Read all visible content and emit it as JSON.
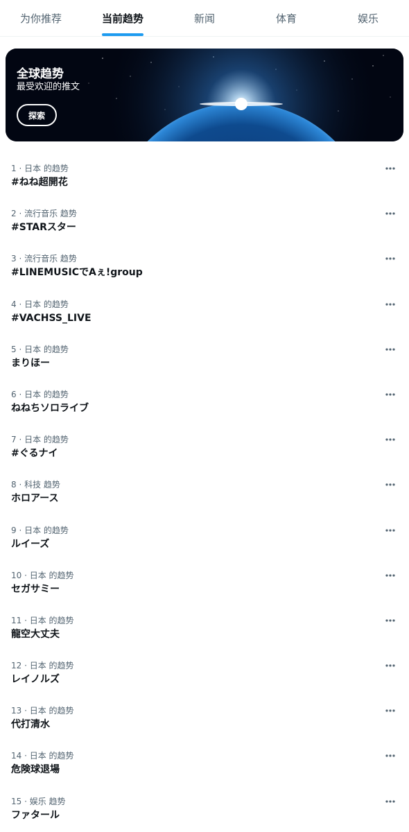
{
  "tabs": [
    {
      "label": "为你推荐",
      "active": false
    },
    {
      "label": "当前趋势",
      "active": true
    },
    {
      "label": "新闻",
      "active": false
    },
    {
      "label": "体育",
      "active": false
    },
    {
      "label": "娱乐",
      "active": false
    }
  ],
  "banner": {
    "title": "全球趋势",
    "subtitle": "最受欢迎的推文",
    "button_label": "探索",
    "image": "earth-at-night-sunrise"
  },
  "trends": [
    {
      "meta": "1 · 日本 的趋势",
      "name": "#ねね超開花"
    },
    {
      "meta": "2 · 流行音乐 趋势",
      "name": "#STARスター"
    },
    {
      "meta": "3 · 流行音乐 趋势",
      "name": "#LINEMUSICでAぇ!group"
    },
    {
      "meta": "4 · 日本 的趋势",
      "name": "#VACHSS_LIVE"
    },
    {
      "meta": "5 · 日本 的趋势",
      "name": "まりほー"
    },
    {
      "meta": "6 · 日本 的趋势",
      "name": "ねねちソロライブ"
    },
    {
      "meta": "7 · 日本 的趋势",
      "name": "#ぐるナイ"
    },
    {
      "meta": "8 · 科技 趋势",
      "name": "ホロアース"
    },
    {
      "meta": "9 · 日本 的趋势",
      "name": "ルイーズ"
    },
    {
      "meta": "10 · 日本 的趋势",
      "name": "セガサミー"
    },
    {
      "meta": "11 · 日本 的趋势",
      "name": "龍空大丈夫"
    },
    {
      "meta": "12 · 日本 的趋势",
      "name": "レイノルズ"
    },
    {
      "meta": "13 · 日本 的趋势",
      "name": "代打清水"
    },
    {
      "meta": "14 · 日本 的趋势",
      "name": "危険球退場"
    },
    {
      "meta": "15 · 娱乐 趋势",
      "name": "ファタール"
    }
  ],
  "icons": {
    "more": "more-horizontal-icon"
  },
  "colors": {
    "accent": "#1d9bf0",
    "text_primary": "#0f1419",
    "text_secondary": "#536471",
    "divider": "#eff3f4"
  }
}
